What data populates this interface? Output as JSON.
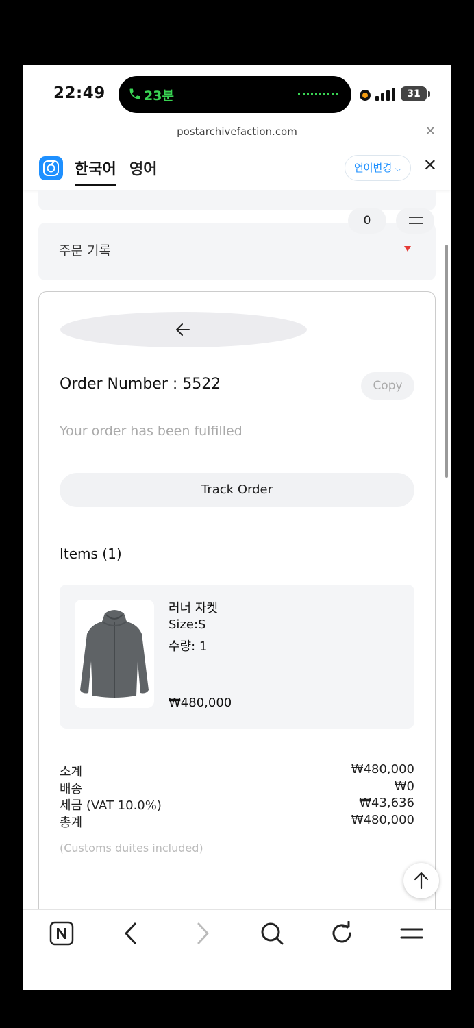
{
  "status_bar": {
    "time": "22:49",
    "call_duration": "23분",
    "battery": "31"
  },
  "browser": {
    "url": "postarchivefaction.com"
  },
  "translate_bar": {
    "source_lang": "한국어",
    "target_lang": "영어",
    "change_lang_label": "언어변경"
  },
  "header": {
    "cart_count": "0"
  },
  "order_history": {
    "label": "주문 기록"
  },
  "order": {
    "number_label": "Order Number : 5522",
    "copy_label": "Copy",
    "status": "Your order has been fulfilled",
    "track_label": "Track Order",
    "items_title": "Items (1)"
  },
  "items": [
    {
      "name": "러너 자켓",
      "size": "Size:S",
      "quantity": "수량: 1",
      "price": "₩480,000"
    }
  ],
  "summary": [
    {
      "label": "소계",
      "value": "₩480,000"
    },
    {
      "label": "배송",
      "value": "₩0"
    },
    {
      "label": "세금 (VAT 10.0%)",
      "value": "₩43,636"
    },
    {
      "label": "총계",
      "value": "₩480,000"
    }
  ],
  "customs_note": "(Customs duites included)",
  "colors": {
    "accent_blue": "#1e90ff",
    "call_green": "#39d353",
    "dropdown_red": "#e53935"
  }
}
